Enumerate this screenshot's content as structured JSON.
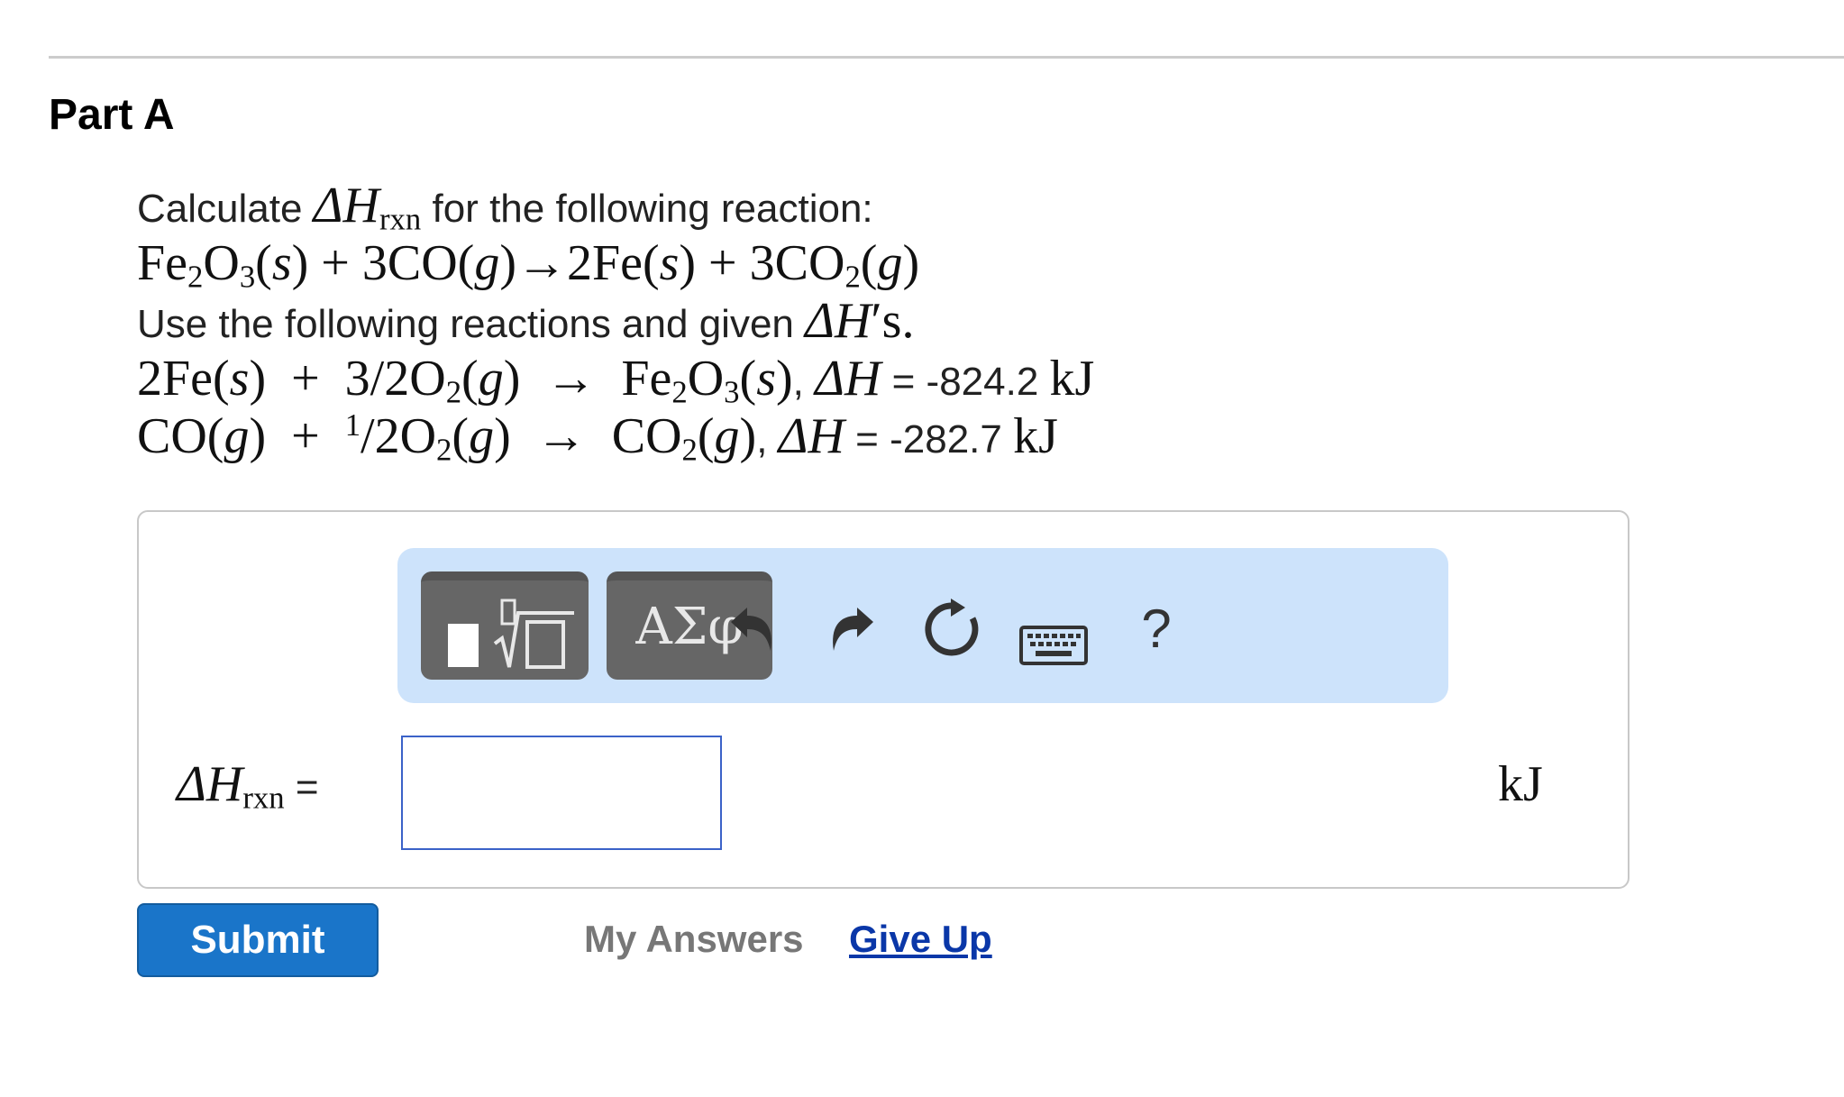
{
  "part": {
    "title": "Part A"
  },
  "problem": {
    "line1": {
      "prefix": "Calculate ",
      "delta": "ΔH",
      "sub": "rxn",
      "suffix": " for the following reaction:"
    },
    "target_reaction": {
      "fe2o3": "Fe",
      "fe2o3_sub1": "2",
      "fe2o3_o": "O",
      "fe2o3_sub2": "3",
      "s1": "(",
      "s1_it": "s",
      "s1_end": ")",
      "plus1": " + 3CO(",
      "g1": "g",
      "arrow1": ")→2Fe(",
      "s2": "s",
      "plus2": ") + 3CO",
      "co2_sub": "2",
      "g2_open": "(",
      "g2": "g",
      "g2_close": ")"
    },
    "line3": {
      "prefix": "Use the following reactions and given ",
      "delta": "ΔH",
      "suffix": "′s."
    },
    "reaction1": {
      "lhs": "2Fe(",
      "s": "s",
      "mid": ")  +  3/2O",
      "o2_sub": "2",
      "g_open": "(",
      "g": "g",
      "arrow": ")  →  Fe",
      "fe_sub": "2",
      "o": "O",
      "o_sub": "3",
      "s2_open": "(",
      "s2": "s",
      "s2_close": ")",
      "comma": ", ",
      "delta": "ΔH",
      "value": " = -824.2 ",
      "unit": "kJ"
    },
    "reaction2": {
      "lhs": "CO(",
      "g": "g",
      "mid": ")  +  ",
      "half_num": "1",
      "half_rest": "/2O",
      "o2_sub": "2",
      "g2_open": "(",
      "g2": "g",
      "arrow": ")  →  CO",
      "co2_sub": "2",
      "g3_open": "(",
      "g3": "g",
      "g3_close": ")",
      "comma": ", ",
      "delta": "ΔH",
      "value": " = -282.7 ",
      "unit": "kJ"
    }
  },
  "toolbar": {
    "symbols_label": "ΑΣφ",
    "help_label": "?"
  },
  "answer": {
    "lhs_delta": "ΔH",
    "lhs_sub": "rxn",
    "lhs_eq": " =",
    "value": "",
    "unit": "kJ"
  },
  "actions": {
    "submit_label": "Submit",
    "my_answers_label": "My Answers",
    "give_up_label": "Give Up"
  }
}
